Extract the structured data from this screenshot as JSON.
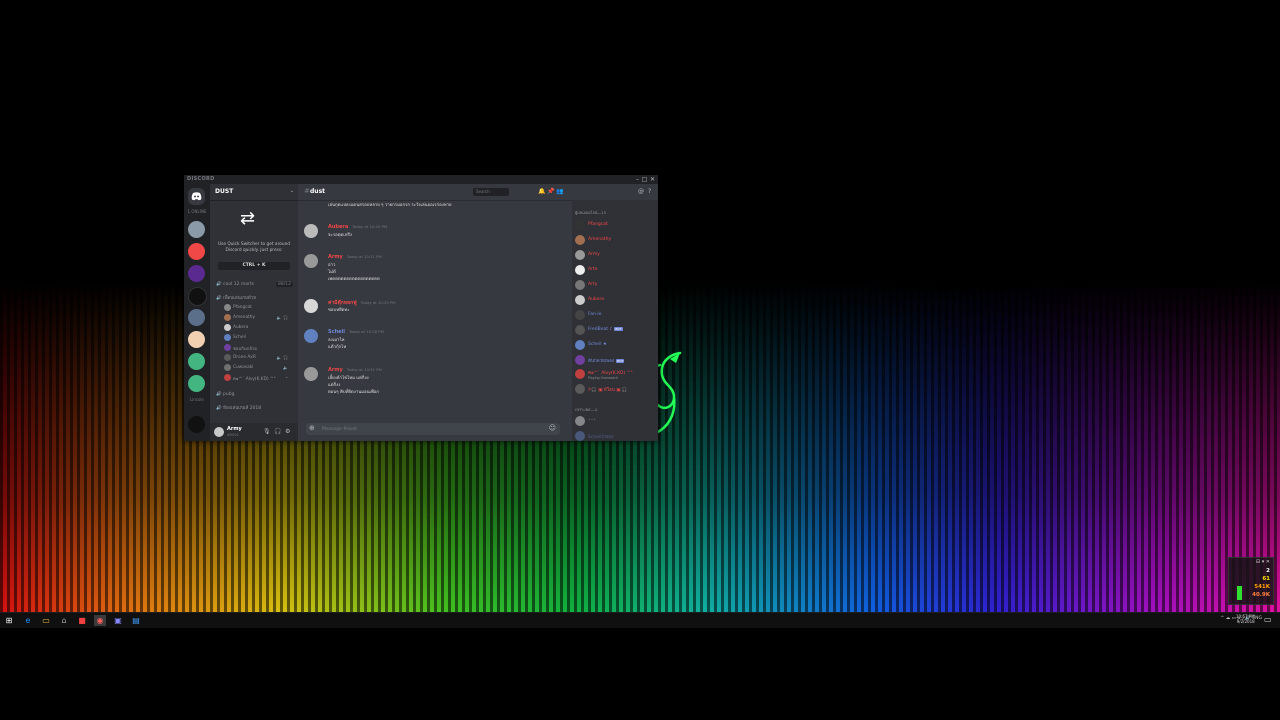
{
  "window": {
    "brand": "DISCORD",
    "controls": [
      "–",
      "□",
      "✕"
    ]
  },
  "guilds": {
    "online_label": "1 ONLINE",
    "bottom_label": "Lincoln"
  },
  "sidebar": {
    "server_name": "DUST",
    "quick_switcher_text": "Use Quick Switcher to get around Discord quickly. Just press:",
    "shortcut": "CTRL + K",
    "categories": [
      {
        "label": "cool 12 marts",
        "count": "88/12"
      },
      {
        "label": "เพื่อนเล่นเกมด้วย"
      },
      {
        "label": "pubg"
      },
      {
        "label": "ห้องเล่นเกมส์ 2018"
      }
    ],
    "voice_users": [
      {
        "name": "Pfangcat",
        "color": "#888888",
        "icons": ""
      },
      {
        "name": "Amenathy",
        "color": "#a07050",
        "icons": "🔈 🎧"
      },
      {
        "name": "Aubera",
        "color": "#cccccc",
        "icons": ""
      },
      {
        "name": "Scheil",
        "color": "#6080c0",
        "icons": ""
      },
      {
        "name": "ชอบกินกล้วย",
        "color": "#7040a0",
        "icons": ""
      },
      {
        "name": "Drone AxR",
        "color": "#5a5a5a",
        "icons": "🔈 🎧"
      },
      {
        "name": "Cuwasaki",
        "color": "#707070",
        "icons": "🔈"
      },
      {
        "name": "ค๑^` Alvy(K.KD) ^°",
        "color": "#c04040",
        "icons": "•"
      }
    ]
  },
  "user_panel": {
    "name": "Army",
    "tag": "#0001",
    "controls": [
      "🎙",
      "🎧",
      "⚙"
    ]
  },
  "chat": {
    "channel": "dust",
    "search_placeholder": "Search",
    "topic": "เล่นกุดแปลงแดนสรอปหลาย ๆ วายกรมอกรก ระวังเล่นออเรก่องหาย",
    "messages": [
      {
        "author": "Aubera",
        "color": "#f04747",
        "avatar": "#bbbbbb",
        "time": "Today at 10:20 PM",
        "lines": [
          "จะรอดุดเหรึง"
        ]
      },
      {
        "author": "Army",
        "color": "#f04747",
        "avatar": "#999999",
        "time": "Today at 10:21 PM",
        "lines": [
          "อ่าว",
          "ไม่ดี",
          "เพตตตตตตตตตตตตตตตตต"
        ]
      },
      {
        "author": "ค่ามีตุ๊กหลกฟู",
        "color": "#f04747",
        "avatar": "#d8d8d8",
        "time": "Today at 10:25 PM",
        "lines": [
          "ขอบหยึดทะ"
        ]
      },
      {
        "author": "Scheil",
        "color": "#7289da",
        "avatar": "#6080c0",
        "time": "Today at 10:28 PM",
        "lines": [
          "ลงเมาไห",
          "แต้วกุ้กไห"
        ]
      },
      {
        "author": "Army",
        "color": "#f04747",
        "avatar": "#999999",
        "time": "Today at 10:31 PM",
        "lines": [
          "เลี้ยงค้าไข่ไหม แต่กิ่งง",
          "แต่กิ่งง",
          "ตอนๆ คิบที่ยิดงานมอนเพือก"
        ]
      }
    ],
    "composer_placeholder": "Message #dust"
  },
  "members": {
    "online_header": "ผู้เล่นออนไลน์—13",
    "offline_header": "OFFLINE—4",
    "online": [
      {
        "name": "Pfangcat",
        "color": "#f04747",
        "avatar": "#333333"
      },
      {
        "name": "Amenathy",
        "color": "#f04747",
        "avatar": "#a07050"
      },
      {
        "name": "Army",
        "color": "#f04747",
        "avatar": "#999999"
      },
      {
        "name": "Arte",
        "color": "#f04747",
        "avatar": "#eeeeee"
      },
      {
        "name": "Arty",
        "color": "#f04747",
        "avatar": "#777777"
      },
      {
        "name": "Aubera",
        "color": "#f04747",
        "avatar": "#cccccc"
      },
      {
        "name": "Fan-ie",
        "color": "#7289da",
        "avatar": "#444444"
      },
      {
        "name": "FredBeat ♪",
        "color": "#7289da",
        "avatar": "#555555",
        "bot": "BOT"
      },
      {
        "name": "Scheil ★",
        "color": "#7289da",
        "avatar": "#6080c0"
      },
      {
        "name": "ต้นกลวยเพลง",
        "color": "#7289da",
        "avatar": "#7040a0",
        "bot": "BOT"
      },
      {
        "name": "ค๑^` Alvy(K.KD) ^°",
        "color": "#f04747",
        "avatar": "#c04040",
        "sub": "Playing Overwatch"
      },
      {
        "name": "ℙ🎧 ▣ ห์ใอน ▣ 🎧",
        "color": "#f04747",
        "avatar": "#5a5a5a"
      }
    ],
    "offline": [
      {
        "name": "•••",
        "color": "#8e9297",
        "avatar": "#dddddd"
      },
      {
        "name": "Scheil(ก่อน)",
        "color": "#7289da",
        "avatar": "#6080c0"
      }
    ]
  },
  "perf": {
    "header": "⊟ ▾ ✕",
    "values": [
      "2",
      "61",
      "541K",
      "40.9K"
    ],
    "colors": [
      "#ffffff",
      "#ffe000",
      "#ffa000",
      "#ff8040"
    ]
  },
  "taskbar": {
    "tray_text": "^ ☁ ▭ ⌂ ◊ 🔊 ENG",
    "clock_time": "10:57 PM",
    "clock_date": "9/2/2018"
  }
}
